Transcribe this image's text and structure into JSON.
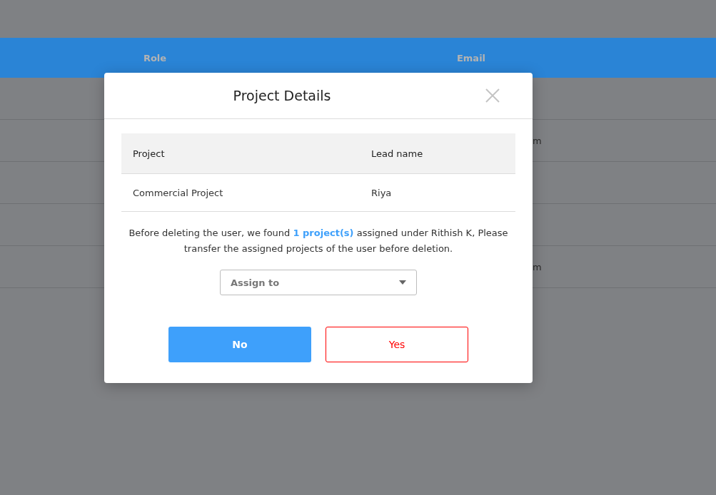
{
  "table": {
    "columns": [
      "Role",
      "Email"
    ],
    "rows": [
      {},
      {
        "email": "m"
      },
      {},
      {},
      {
        "email": "m"
      }
    ]
  },
  "dialog": {
    "title": "Project Details",
    "table": {
      "columns": [
        "Project",
        "Lead name"
      ],
      "rows": [
        [
          "Commercial Project",
          "Riya"
        ]
      ]
    },
    "message": "Before deleting the user, we found **1 project(s)** assigned under Rithish K, Please transfer the assigned projects of the user before deletion.",
    "assign_dropdown": {
      "placeholder": "Assign to"
    },
    "buttons": [
      {
        "label": "No",
        "kind": "primary"
      },
      {
        "label": "Yes",
        "kind": "danger"
      }
    ]
  }
}
